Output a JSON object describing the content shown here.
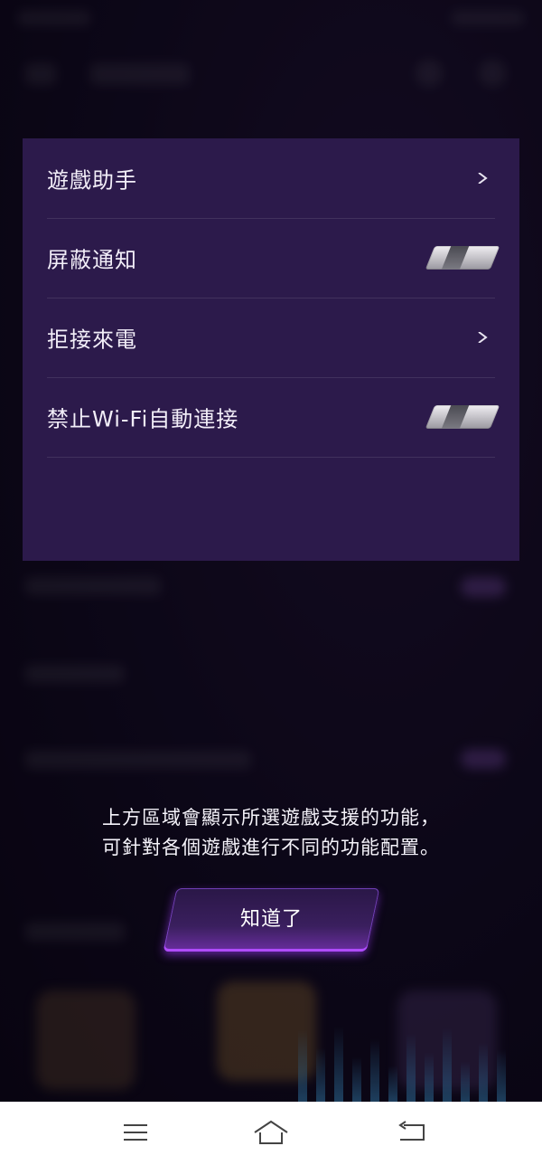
{
  "colors": {
    "panel_background": "#2c1a4b",
    "button_accent": "#b04cff",
    "navbar_background": "#ffffff"
  },
  "panel": {
    "items": [
      {
        "label": "遊戲助手",
        "control": "chevron",
        "icon": "chevron-right-icon"
      },
      {
        "label": "屏蔽通知",
        "control": "toggle",
        "state": "off"
      },
      {
        "label": "拒接來電",
        "control": "chevron",
        "icon": "chevron-right-icon"
      },
      {
        "label": "禁止Wi-Fi自動連接",
        "control": "toggle",
        "state": "off"
      }
    ]
  },
  "hint": {
    "line1": "上方區域會顯示所選遊戲支援的功能，",
    "line2": "可針對各個遊戲進行不同的功能配置。"
  },
  "got_it_button": {
    "label": "知道了"
  },
  "navbar": {
    "buttons": [
      {
        "name": "menu",
        "icon": "menu-icon"
      },
      {
        "name": "home",
        "icon": "home-icon"
      },
      {
        "name": "back",
        "icon": "back-icon"
      }
    ]
  }
}
